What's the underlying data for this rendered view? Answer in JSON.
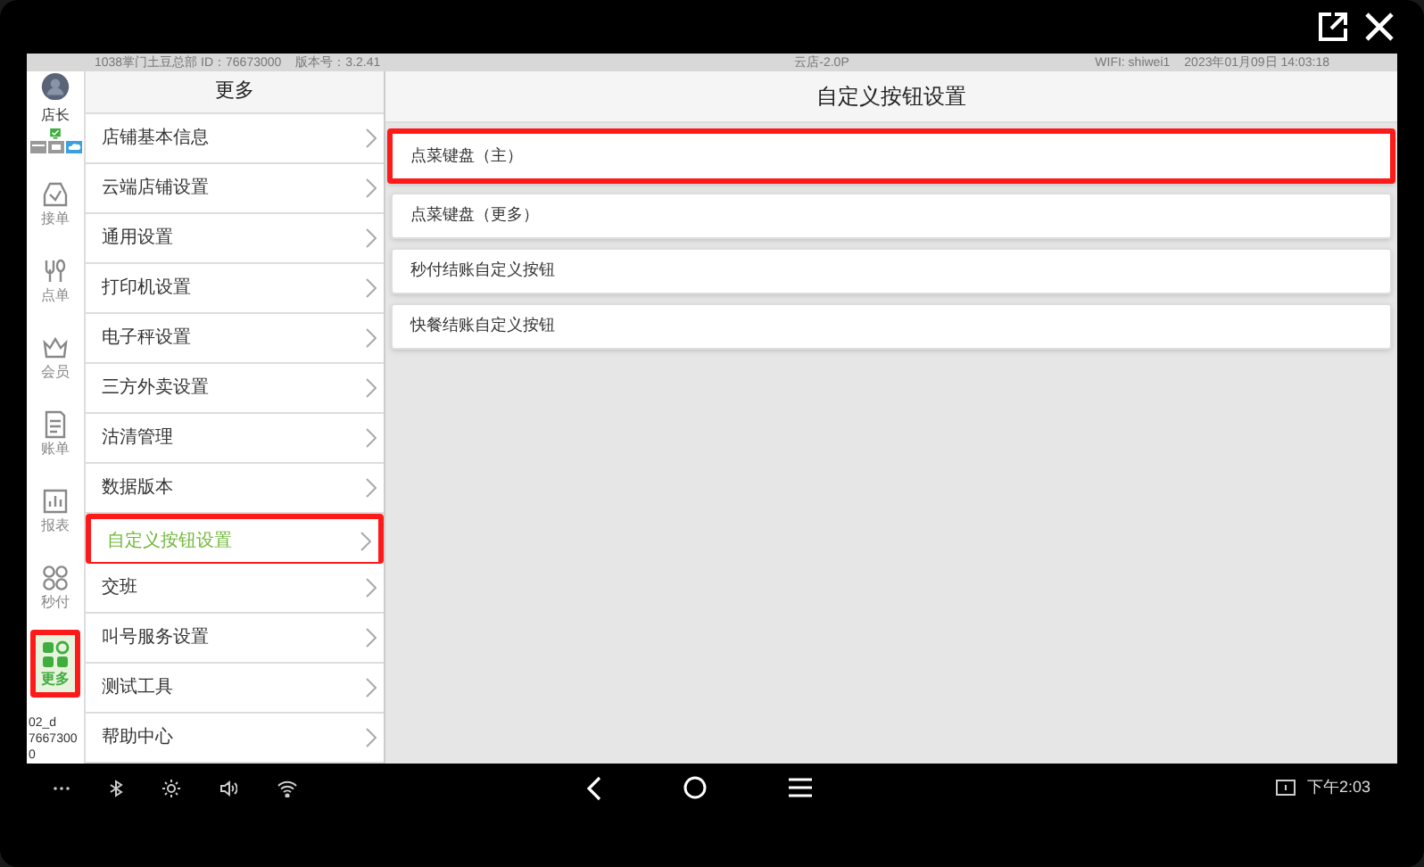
{
  "status_bar": {
    "store": "1038掌门土豆总部 ID：76673000",
    "version": "版本号：3.2.41",
    "center": "云店-2.0P",
    "wifi": "WIFI: shiwei1",
    "datetime": "2023年01月09日 14:03:18"
  },
  "user": {
    "role": "店长"
  },
  "rail": [
    {
      "label": "接单",
      "kind": "inbox",
      "selected": false,
      "highlighted": false
    },
    {
      "label": "点单",
      "kind": "dining",
      "selected": false,
      "highlighted": false
    },
    {
      "label": "会员",
      "kind": "crown",
      "selected": false,
      "highlighted": false
    },
    {
      "label": "账单",
      "kind": "bill",
      "selected": false,
      "highlighted": false
    },
    {
      "label": "报表",
      "kind": "report",
      "selected": false,
      "highlighted": false
    },
    {
      "label": "秒付",
      "kind": "grid",
      "selected": false,
      "highlighted": false
    },
    {
      "label": "更多",
      "kind": "more",
      "selected": true,
      "highlighted": true
    }
  ],
  "device": {
    "name": "02_d",
    "number": "7667300",
    "suffix": "0"
  },
  "menu": {
    "title": "更多",
    "items": [
      {
        "label": "店铺基本信息",
        "selected": false,
        "highlighted": false
      },
      {
        "label": "云端店铺设置",
        "selected": false,
        "highlighted": false
      },
      {
        "label": "通用设置",
        "selected": false,
        "highlighted": false
      },
      {
        "label": "打印机设置",
        "selected": false,
        "highlighted": false
      },
      {
        "label": "电子秤设置",
        "selected": false,
        "highlighted": false
      },
      {
        "label": "三方外卖设置",
        "selected": false,
        "highlighted": false
      },
      {
        "label": "沽清管理",
        "selected": false,
        "highlighted": false
      },
      {
        "label": "数据版本",
        "selected": false,
        "highlighted": false
      },
      {
        "label": "自定义按钮设置",
        "selected": true,
        "highlighted": true
      },
      {
        "label": "交班",
        "selected": false,
        "highlighted": false
      },
      {
        "label": "叫号服务设置",
        "selected": false,
        "highlighted": false
      },
      {
        "label": "测试工具",
        "selected": false,
        "highlighted": false
      },
      {
        "label": "帮助中心",
        "selected": false,
        "highlighted": false
      }
    ]
  },
  "panel": {
    "title": "自定义按钮设置",
    "items": [
      {
        "label": "点菜键盘（主）",
        "highlighted": true
      },
      {
        "label": "点菜键盘（更多）",
        "highlighted": false
      },
      {
        "label": "秒付结账自定义按钮",
        "highlighted": false
      },
      {
        "label": "快餐结账自定义按钮",
        "highlighted": false
      }
    ]
  },
  "nav_bar": {
    "time": "下午2:03"
  }
}
